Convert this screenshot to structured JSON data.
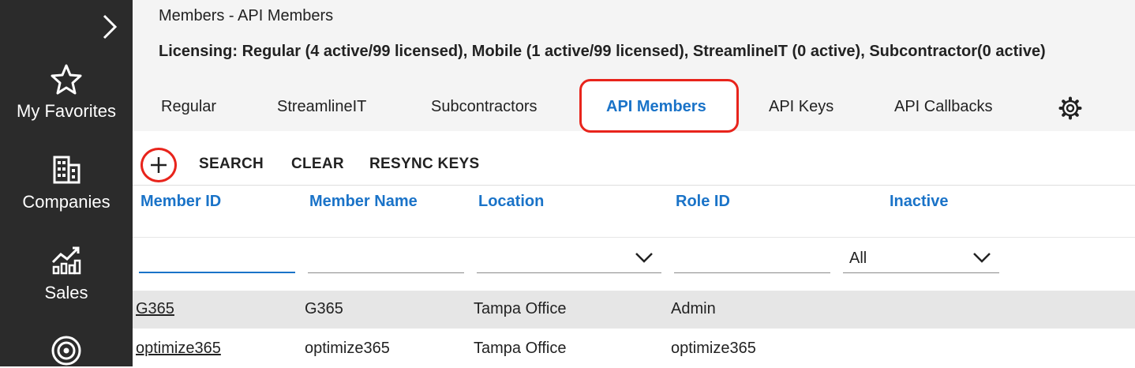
{
  "sidebar": {
    "items": [
      {
        "label": "My Favorites",
        "icon": "star-icon"
      },
      {
        "label": "Companies",
        "icon": "building-icon"
      },
      {
        "label": "Sales",
        "icon": "chart-icon"
      },
      {
        "label": "",
        "icon": "target-icon"
      }
    ]
  },
  "header": {
    "breadcrumb": "Members - API Members",
    "licensing": "Licensing: Regular (4 active/99 licensed), Mobile (1 active/99 licensed), StreamlineIT (0 active), Subcontractor(0 active)"
  },
  "tabs": [
    {
      "label": "Regular"
    },
    {
      "label": "StreamlineIT"
    },
    {
      "label": "Subcontractors"
    },
    {
      "label": "API Members",
      "active": true
    },
    {
      "label": "API Keys"
    },
    {
      "label": "API Callbacks"
    }
  ],
  "toolbar": {
    "search": "SEARCH",
    "clear": "CLEAR",
    "resync": "RESYNC KEYS"
  },
  "table": {
    "columns": [
      "Member ID",
      "Member Name",
      "Location",
      "Role ID",
      "Inactive"
    ],
    "filters": {
      "member_id": "",
      "member_name": "",
      "location": "",
      "role_id": "",
      "inactive": "All"
    },
    "rows": [
      {
        "member_id": "G365",
        "member_name": "G365",
        "location": "Tampa Office",
        "role_id": "Admin"
      },
      {
        "member_id": "optimize365",
        "member_name": "optimize365",
        "location": "Tampa Office",
        "role_id": "optimize365"
      }
    ]
  },
  "colors": {
    "sidebar_bg": "#2b2b2b",
    "accent_blue": "#1a73c8",
    "highlight_red": "#e8241c"
  }
}
